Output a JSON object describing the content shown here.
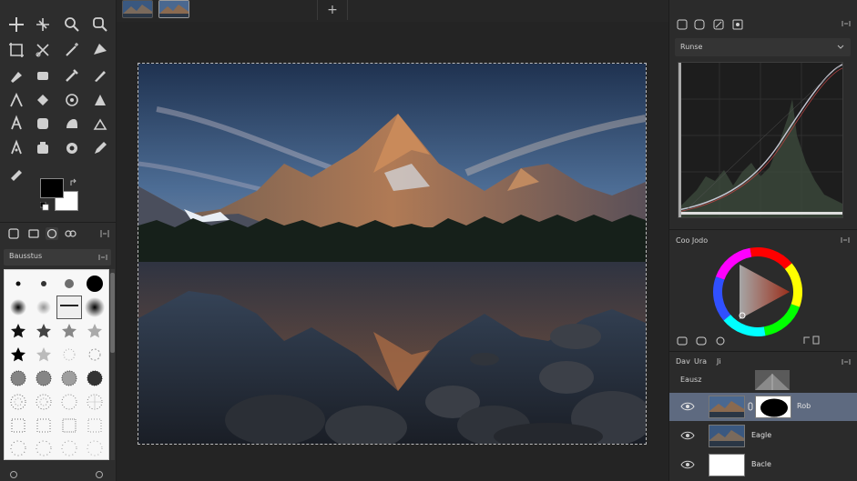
{
  "colors": {
    "accent_selected_layer": "#5e6a80",
    "foreground": "#000000",
    "background": "#ffffff"
  },
  "toolbox": {
    "tools": [
      "move-icon",
      "crosshair-move-icon",
      "zoom-icon",
      "lasso-zoom-icon",
      "crop-icon",
      "scissors-icon",
      "magic-wand-icon",
      "ruler-icon",
      "brush-icon",
      "eraser-icon",
      "pipette-icon",
      "pen-icon",
      "text-icon",
      "bucket-icon",
      "smudge-icon",
      "clone-icon",
      "path-icon",
      "blur-icon",
      "dodge-icon",
      "sponge-icon",
      "measure-icon",
      "hand-icon",
      "stamp-icon",
      "pencil-icon",
      "color-picker-icon"
    ],
    "tab_icons": [
      "brushes-tab-icon",
      "patterns-tab-icon",
      "gradients-tab-icon",
      "palettes-tab-icon"
    ],
    "brushes_title": "Bausstus"
  },
  "canvas": {
    "tabs": [
      "mountain-lake-thumbnail-1",
      "mountain-lake-thumbnail-2"
    ],
    "add_tab_label": "+"
  },
  "right_panel": {
    "curves_title": "Runse",
    "color_title": "Coo Jodo",
    "layers_tabs": [
      "Dav",
      "Ura",
      "Ji"
    ],
    "layers_header_label": "Eausz",
    "layers": [
      {
        "name": "Rob",
        "selected": true,
        "visible": true,
        "has_mask": true
      },
      {
        "name": "Eagle",
        "selected": false,
        "visible": true,
        "has_mask": false
      },
      {
        "name": "Bacle",
        "selected": false,
        "visible": true,
        "has_mask": false
      }
    ]
  }
}
